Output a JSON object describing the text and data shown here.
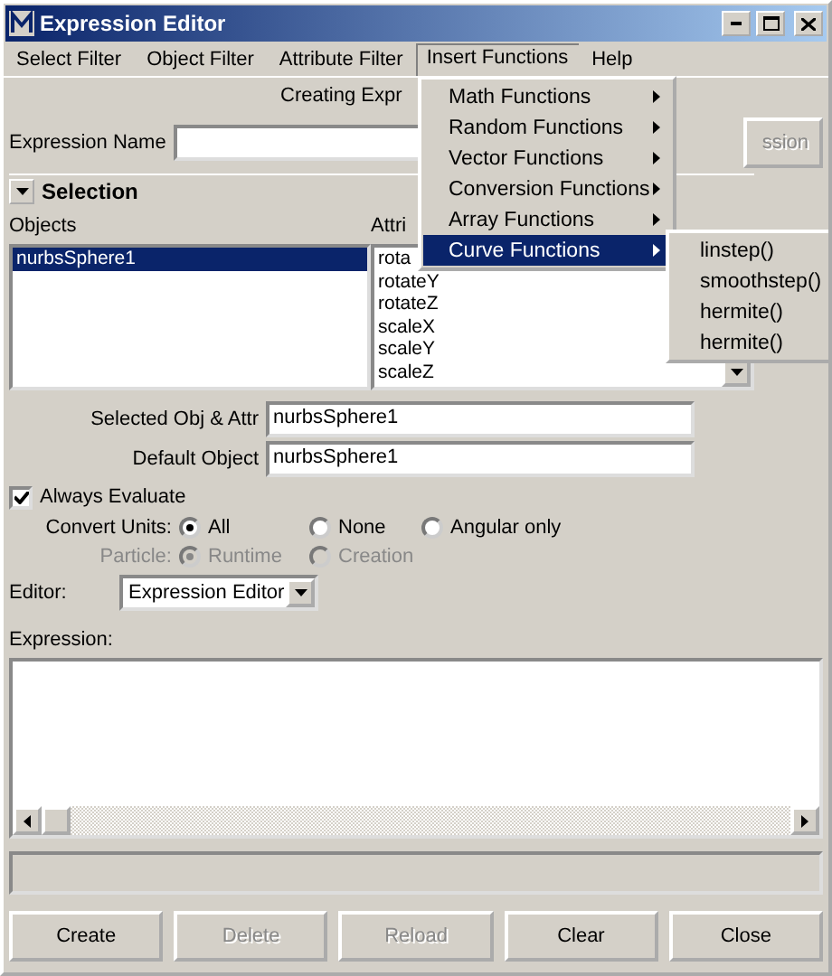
{
  "window": {
    "title": "Expression Editor"
  },
  "menu_bar": [
    {
      "label": "Select Filter",
      "selected": false
    },
    {
      "label": "Object Filter",
      "selected": false
    },
    {
      "label": "Attribute Filter",
      "selected": false
    },
    {
      "label": "Insert Functions",
      "selected": true
    },
    {
      "label": "Help",
      "selected": false
    }
  ],
  "insert_menu": [
    {
      "label": "Math Functions",
      "selected": false
    },
    {
      "label": "Random Functions",
      "selected": false
    },
    {
      "label": "Vector Functions",
      "selected": false
    },
    {
      "label": "Conversion Functions",
      "selected": false
    },
    {
      "label": "Array Functions",
      "selected": false
    },
    {
      "label": "Curve Functions",
      "selected": true
    }
  ],
  "curve_submenu": [
    "linstep()",
    "smoothstep()",
    "hermite()",
    "hermite()"
  ],
  "heading": "Creating Expr",
  "expression_name": {
    "label": "Expression Name"
  },
  "side_button": {
    "label": "ssion",
    "disabled": true
  },
  "selection": {
    "title": "Selection",
    "expanded": true,
    "objects_label": "Objects",
    "attributes_label": "Attri",
    "objects": [
      {
        "name": "nurbsSphere1",
        "selected": true
      }
    ],
    "attributes": [
      "rota",
      "rotateY",
      "rotateZ",
      "scaleX",
      "scaleY",
      "scaleZ"
    ]
  },
  "fields": [
    {
      "label": "Selected Obj & Attr",
      "value": "nurbsSphere1"
    },
    {
      "label": "Default Object",
      "value": "nurbsSphere1"
    }
  ],
  "always_evaluate": {
    "label": "Always Evaluate",
    "checked": true
  },
  "convert_units": {
    "label": "Convert Units:",
    "disabled": false,
    "options": [
      {
        "label": "All",
        "selected": true
      },
      {
        "label": "None",
        "selected": false
      },
      {
        "label": "Angular only",
        "selected": false
      }
    ]
  },
  "particle": {
    "label": "Particle:",
    "disabled": true,
    "options": [
      {
        "label": "Runtime",
        "selected": true
      },
      {
        "label": "Creation",
        "selected": false
      }
    ]
  },
  "editor": {
    "label": "Editor:",
    "value": "Expression Editor"
  },
  "expression": {
    "label": "Expression:"
  },
  "buttons": [
    {
      "label": "Create",
      "disabled": false
    },
    {
      "label": "Delete",
      "disabled": true
    },
    {
      "label": "Reload",
      "disabled": true
    },
    {
      "label": "Clear",
      "disabled": false
    },
    {
      "label": "Close",
      "disabled": false
    }
  ]
}
